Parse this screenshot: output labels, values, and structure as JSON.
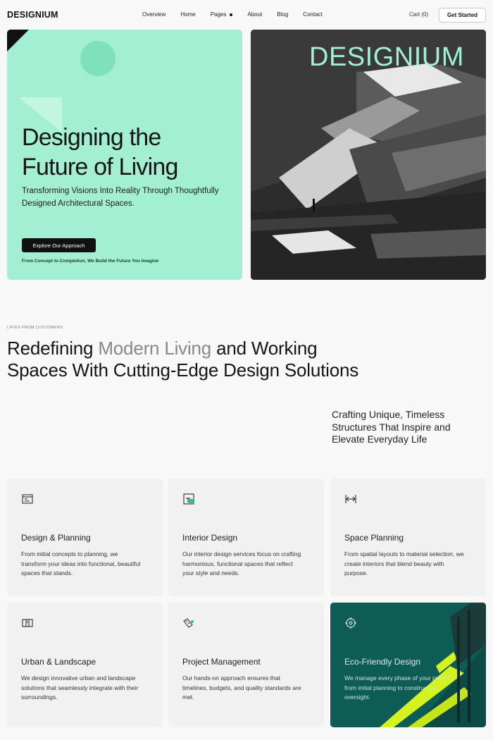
{
  "nav": {
    "logo": "DESIGNIUM",
    "links": [
      "Overview",
      "Home",
      "Pages",
      "About",
      "Blog",
      "Contact"
    ],
    "cart": "Cart (0)",
    "cta": "Get Started"
  },
  "hero": {
    "title_line1": "Designing the",
    "title_line2": "Future of Living",
    "subtitle": "Transforming Visions Into Reality Through Thoughtfully Designed Architectural Spaces.",
    "button": "Explore Our Approach",
    "footnote": "From Concept to Completion, We Build the Future You Imagine",
    "brand_overlay": "DESIGNIUM",
    "accent_color": "#a2efd4"
  },
  "section": {
    "eyebrow": "LATES FROM CUSTOMERS",
    "headline_a": "Redefining ",
    "headline_muted": "Modern Living",
    "headline_b": " and Working Spaces With Cutting-Edge Design Solutions",
    "sideline": "Crafting Unique, Timeless Structures That Inspire and Elevate Everyday Life"
  },
  "cards": [
    {
      "title": "Design & Planning",
      "desc": "From initial concepts to planning, we transform your ideas into functional, beautiful spaces that stands.",
      "icon": "layout-icon"
    },
    {
      "title": "Interior Design",
      "desc": "Our interior design services focus on crafting harmonious, functional spaces that reflect your style and needs.",
      "icon": "interior-icon"
    },
    {
      "title": "Space Planning",
      "desc": "From spatial layouts to material selection, we create interiors that blend beauty with purpose.",
      "icon": "width-arrows-icon"
    },
    {
      "title": "Urban & Landscape",
      "desc": "We design innovative urban and landscape solutions that seamlessly integrate with their surroundings.",
      "icon": "map-icon"
    },
    {
      "title": "Project Management",
      "desc": "Our hands-on approach ensures that timelines, budgets, and quality standards are met.",
      "icon": "ruler-pencil-icon"
    },
    {
      "title": "Eco-Friendly Design",
      "desc": "We manage every phase of your project, from initial planning to construction oversight.",
      "icon": "eco-target-icon"
    }
  ]
}
